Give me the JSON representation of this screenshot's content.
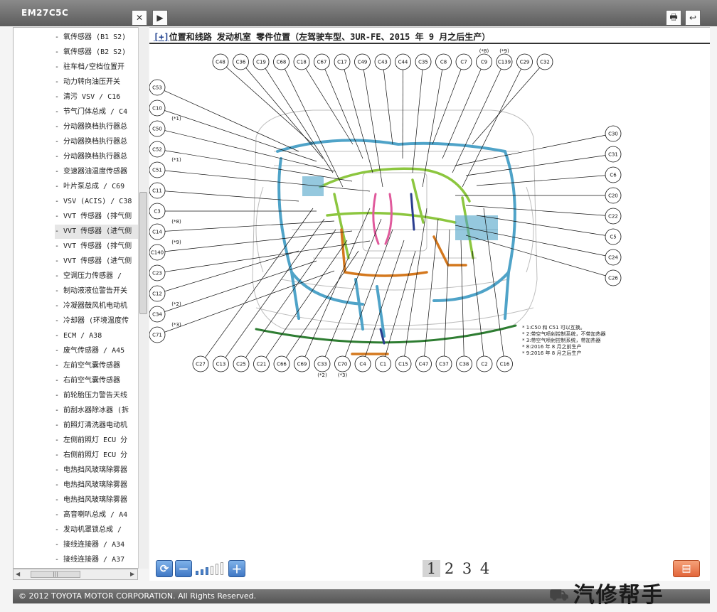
{
  "window": {
    "doc_id": "EM27C5C"
  },
  "titlebar_buttons": {
    "close": "✕",
    "next": "▶",
    "print": "🖶",
    "back": "↩"
  },
  "heading": {
    "link": "[+]",
    "text": "位置和线路  发动机室  零件位置（左驾驶车型、3UR-FE、2015 年 9 月之后生产）"
  },
  "sidebar": {
    "items": [
      "-  氧传感器 (B1 S2)",
      "-  氧传感器 (B2 S2)",
      "-  驻车档/空档位置开",
      "-  动力转向油压开关",
      "-  清污 VSV / C16",
      "-  节气门体总成 / C4",
      "-  分动器换档执行器总",
      "-  分动器换档执行器总",
      "-  分动器换档执行器总",
      "-  变速器油温度传感器",
      "-  叶片泵总成 / C69",
      "-  VSV (ACIS) / C38",
      "-  VVT 传感器 (排气侧",
      "-  VVT 传感器 (进气侧",
      "-  VVT 传感器 (排气侧",
      "-  VVT 传感器 (进气侧",
      "-  空调压力传感器 /",
      "-  制动液液位警告开关",
      "-  冷凝器鼓风机电动机",
      "-  冷却器 (环境温度传",
      "-  ECM / A38",
      "-  废气传感器 / A45",
      "-  左前空气囊传感器",
      "-  右前空气囊传感器",
      "-  前轮胎压力警告天线",
      "-  前刮水器除冰器 (拆",
      "-  前照灯清洗器电动机",
      "-  左侧前照灯 ECU 分",
      "-  右侧前照灯 ECU 分",
      "-  电热挡风玻璃除雾器",
      "-  电热挡风玻璃除雾器",
      "-  电热挡风玻璃除雾器",
      "-  高音喇叭总成 / A4",
      "-  发动机罩锁总成 /",
      "-  接线连接器 / A34",
      "-  接线连接器 / A37"
    ],
    "active_index": 13
  },
  "hscroll": {
    "left": "◀",
    "right": "▶",
    "thumb": "|||"
  },
  "diagram": {
    "top_labels": [
      "C48",
      "C36",
      "C19",
      "C68",
      "C18",
      "C67",
      "C17",
      "C49",
      "C43",
      "C44",
      "C35",
      "C8",
      "C7",
      "C9",
      "C139",
      "C29",
      "C32"
    ],
    "top_notes": {
      "C9": "(*8)",
      "C139": "(*9)"
    },
    "left_labels": [
      "C53",
      "C10",
      "C50",
      "C52",
      "C51",
      "C11",
      "C3",
      "C14",
      "C140",
      "C23",
      "C12",
      "C34",
      "C71"
    ],
    "left_notes": {
      "C50": "(*1)",
      "C51": "(*1)",
      "C14": "(*8)",
      "C140": "(*9)",
      "C34": "(*2)",
      "C71": "(*3)"
    },
    "right_labels": [
      "C30",
      "C31",
      "C6",
      "C20",
      "C22",
      "C5",
      "C24",
      "C26"
    ],
    "bottom_labels": [
      "C27",
      "C13",
      "C25",
      "C21",
      "C66",
      "C69",
      "C33",
      "C70",
      "C4",
      "C1",
      "C15",
      "C47",
      "C37",
      "C38",
      "C2",
      "C16"
    ],
    "bottom_notes": {
      "C33": "(*2)",
      "C70": "(*3)"
    },
    "notes": [
      "* 1:C50 和 C51 可以互换。",
      "* 2:带空气喷射控制系统，不带加热器",
      "* 3:带空气喷射控制系统，带加热器",
      "* 8:2016 年 8 月之前生产",
      "* 9:2016 年 8 月之后生产"
    ]
  },
  "toolbar": {
    "refresh": "⟳",
    "zoom_out": "－",
    "zoom_in": "＋",
    "zoom_level": 3,
    "zoom_steps": 6
  },
  "pager": {
    "pages": [
      "1",
      "2",
      "3",
      "4"
    ],
    "current": "1"
  },
  "print_icon": "▤",
  "footer": {
    "copyright": "© 2012 TOYOTA MOTOR CORPORATION. All Rights Reserved."
  },
  "watermark": {
    "text": "汽修帮手",
    "logo": "⛟"
  },
  "colors": {
    "harness_blue": "#4fa3c8",
    "harness_green": "#8cc63f",
    "harness_orange": "#d4781e",
    "harness_pink": "#e05a9c",
    "harness_darkgreen": "#2e7d32",
    "harness_navy": "#2a3d8f"
  }
}
